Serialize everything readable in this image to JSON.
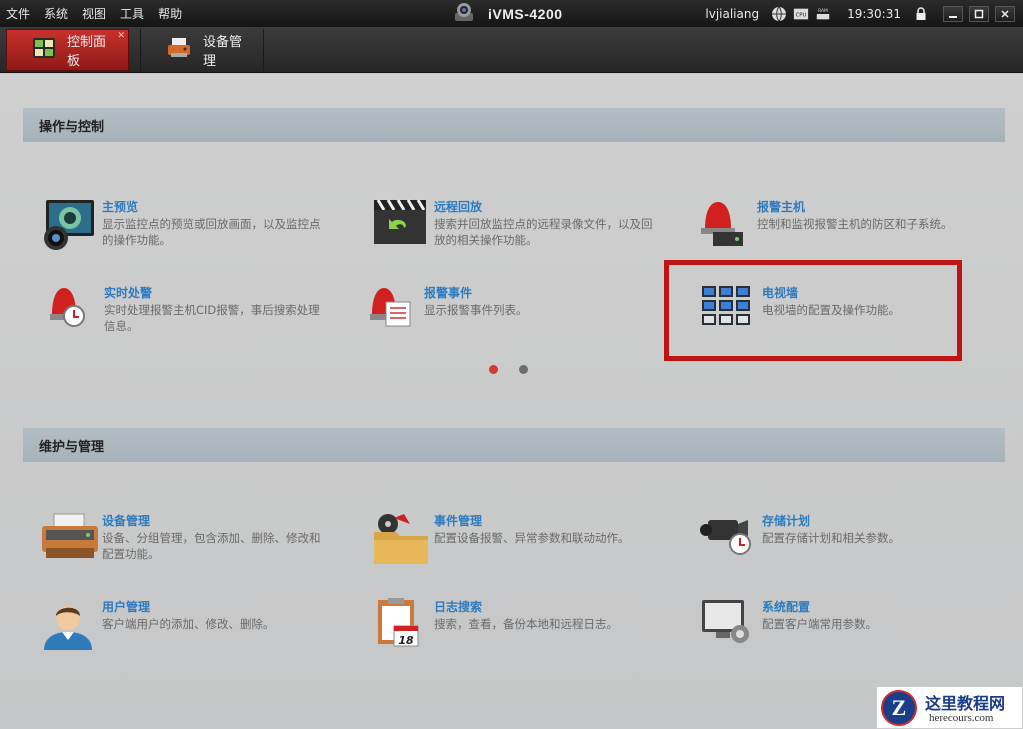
{
  "titlebar": {
    "menu": [
      "文件",
      "系统",
      "视图",
      "工具",
      "帮助"
    ],
    "app_name": "iVMS-4200",
    "user": "lvjialiang",
    "time": "19:30:31",
    "cpu_label": "CPU",
    "ram_label": "RAM"
  },
  "tabs": [
    {
      "label": "控制面板",
      "active": true
    },
    {
      "label": "设备管理",
      "active": false
    }
  ],
  "sections": {
    "ops": {
      "title": "操作与控制",
      "items": [
        {
          "title": "主预览",
          "desc": "显示监控点的预览或回放画面，以及监控点的操作功能。"
        },
        {
          "title": "远程回放",
          "desc": "搜索并回放监控点的远程录像文件，以及回放的相关操作功能。"
        },
        {
          "title": "报警主机",
          "desc": "控制和监视报警主机的防区和子系统。"
        },
        {
          "title": "实时处警",
          "desc": "实时处理报警主机CID报警，事后搜索处理信息。"
        },
        {
          "title": "报警事件",
          "desc": "显示报警事件列表。"
        },
        {
          "title": "电视墙",
          "desc": "电视墙的配置及操作功能。"
        }
      ]
    },
    "maint": {
      "title": "维护与管理",
      "items": [
        {
          "title": "设备管理",
          "desc": "设备、分组管理，包含添加、删除、修改和配置功能。"
        },
        {
          "title": "事件管理",
          "desc": "配置设备报警、异常参数和联动动作。"
        },
        {
          "title": "存储计划",
          "desc": "配置存储计划和相关参数。"
        },
        {
          "title": "用户管理",
          "desc": "客户端用户的添加、修改、删除。"
        },
        {
          "title": "日志搜索",
          "desc": "搜索，查看，备份本地和远程日志。"
        },
        {
          "title": "系统配置",
          "desc": "配置客户端常用参数。"
        }
      ]
    }
  },
  "calendar_day": "18",
  "pagination": {
    "total": 2,
    "current": 1
  },
  "colors": {
    "accent_red": "#c8312b",
    "link_blue": "#2e7bbf",
    "highlight_red": "#c01414"
  },
  "watermark": {
    "logo_letter": "Z",
    "cn": "这里教程网",
    "en": "herecours.com"
  }
}
